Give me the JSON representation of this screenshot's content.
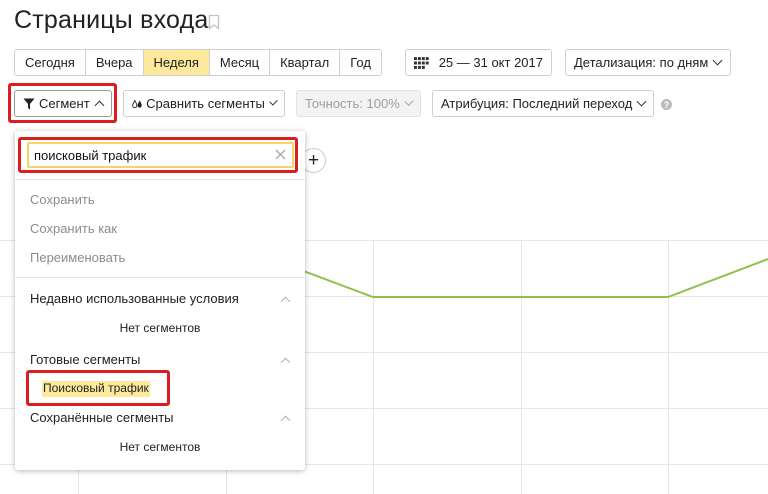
{
  "page": {
    "title": "Страницы входа"
  },
  "period": {
    "items": [
      {
        "label": "Сегодня",
        "active": false
      },
      {
        "label": "Вчера",
        "active": false
      },
      {
        "label": "Неделя",
        "active": true
      },
      {
        "label": "Месяц",
        "active": false
      },
      {
        "label": "Квартал",
        "active": false
      },
      {
        "label": "Год",
        "active": false
      }
    ]
  },
  "date_range": {
    "label": "25 — 31 окт 2017",
    "icon": "calendar-icon"
  },
  "detail": {
    "label": "Детализация: по дням"
  },
  "toolbar": {
    "segment_label": "Сегмент",
    "compare_label": "Сравнить сегменты",
    "accuracy_label": "Точность: 100%",
    "attribution_label": "Атрибуция: Последний переход",
    "help_label": "?",
    "add_label": "+"
  },
  "dropdown": {
    "search": {
      "value": "поисковый трафик",
      "placeholder": ""
    },
    "actions": [
      "Сохранить",
      "Сохранить как",
      "Переименовать"
    ],
    "groups": {
      "recent": {
        "title": "Недавно использованные условия",
        "empty": "Нет сегментов"
      },
      "ready": {
        "title": "Готовые сегменты",
        "items": [
          "Поисковый трафик"
        ]
      },
      "saved": {
        "title": "Сохранённые сегменты",
        "empty": "Нет сегментов"
      }
    }
  },
  "colors": {
    "active_tab": "#fde99b",
    "highlight_box": "#d81e1e",
    "chart_line": "#8bc34a",
    "search_border": "#f5d565"
  }
}
